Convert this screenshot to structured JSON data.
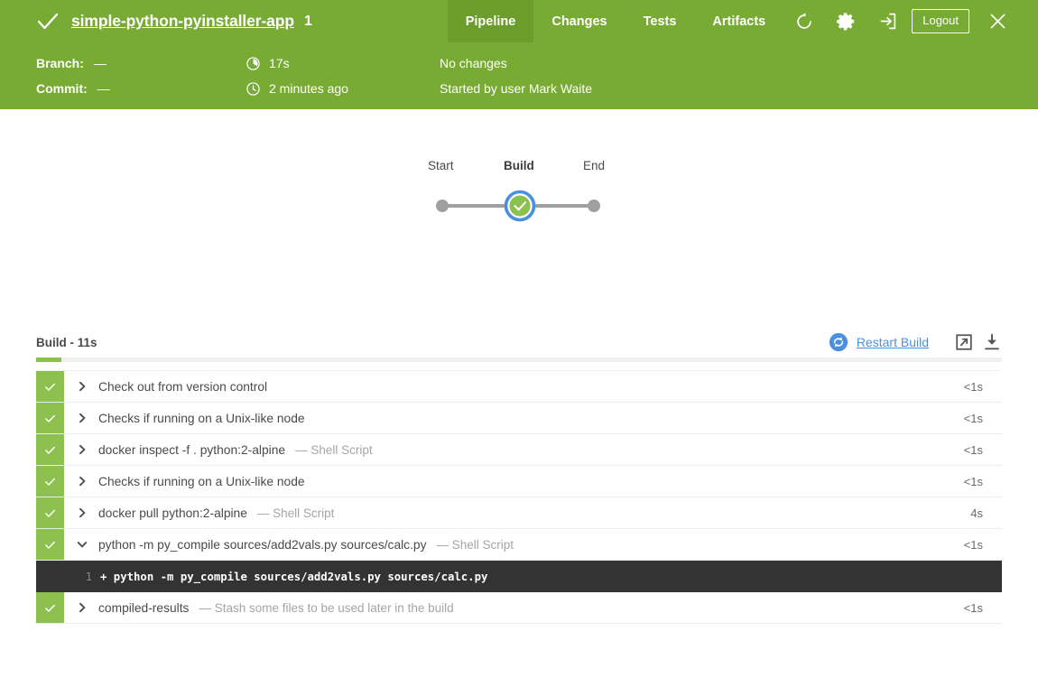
{
  "header": {
    "status_icon": "checkmark-icon",
    "pipeline_name": "simple-python-pyinstaller-app",
    "run_number": "1",
    "tabs": [
      {
        "label": "Pipeline",
        "active": true
      },
      {
        "label": "Changes",
        "active": false
      },
      {
        "label": "Tests",
        "active": false
      },
      {
        "label": "Artifacts",
        "active": false
      }
    ],
    "actions": {
      "rerun_icon": "rerun-icon",
      "settings_icon": "gear-icon",
      "logout_arrow_icon": "logout-arrow-icon",
      "logout_label": "Logout",
      "close_icon": "close-icon"
    },
    "colors": {
      "header_green": "#78ab33",
      "active_tab_green": "#6b9c2c",
      "status_green": "#8cc04f",
      "link_blue": "#4a90e2",
      "selection_blue": "#4a90e2",
      "console_dark": "#333333"
    }
  },
  "meta": {
    "branch_label": "Branch:",
    "branch_value": "—",
    "commit_label": "Commit:",
    "commit_value": "—",
    "duration_icon": "duration-icon",
    "duration_value": "17s",
    "time_icon": "clock-icon",
    "time_value": "2 minutes ago",
    "changes_value": "No changes",
    "cause_value": "Started by user Mark Waite"
  },
  "graph": {
    "nodes": [
      {
        "label": "Start",
        "type": "dot",
        "selected": false
      },
      {
        "label": "Build",
        "type": "success",
        "selected": true
      },
      {
        "label": "End",
        "type": "dot",
        "selected": false
      }
    ]
  },
  "results": {
    "title": "Build - 11s",
    "restart_icon": "restart-icon",
    "restart_label": "Restart Build",
    "open_external_icon": "external-link-icon",
    "download_icon": "download-icon",
    "steps": [
      {
        "status": "success",
        "expanded": false,
        "text": "Check out from version control",
        "sub": "",
        "duration": "<1s"
      },
      {
        "status": "success",
        "expanded": false,
        "text": "Checks if running on a Unix-like node",
        "sub": "",
        "duration": "<1s"
      },
      {
        "status": "success",
        "expanded": false,
        "text": "docker inspect -f . python:2-alpine",
        "sub": "— Shell Script",
        "duration": "<1s"
      },
      {
        "status": "success",
        "expanded": false,
        "text": "Checks if running on a Unix-like node",
        "sub": "",
        "duration": "<1s"
      },
      {
        "status": "success",
        "expanded": false,
        "text": "docker pull python:2-alpine",
        "sub": "— Shell Script",
        "duration": "4s"
      },
      {
        "status": "success",
        "expanded": true,
        "text": "python -m py_compile sources/add2vals.py sources/calc.py",
        "sub": "— Shell Script",
        "duration": "<1s",
        "console": [
          {
            "line": "1",
            "text": "+ python -m py_compile sources/add2vals.py sources/calc.py"
          }
        ]
      },
      {
        "status": "success",
        "expanded": false,
        "text": "compiled-results",
        "sub": "— Stash some files to be used later in the build",
        "duration": "<1s"
      }
    ]
  }
}
